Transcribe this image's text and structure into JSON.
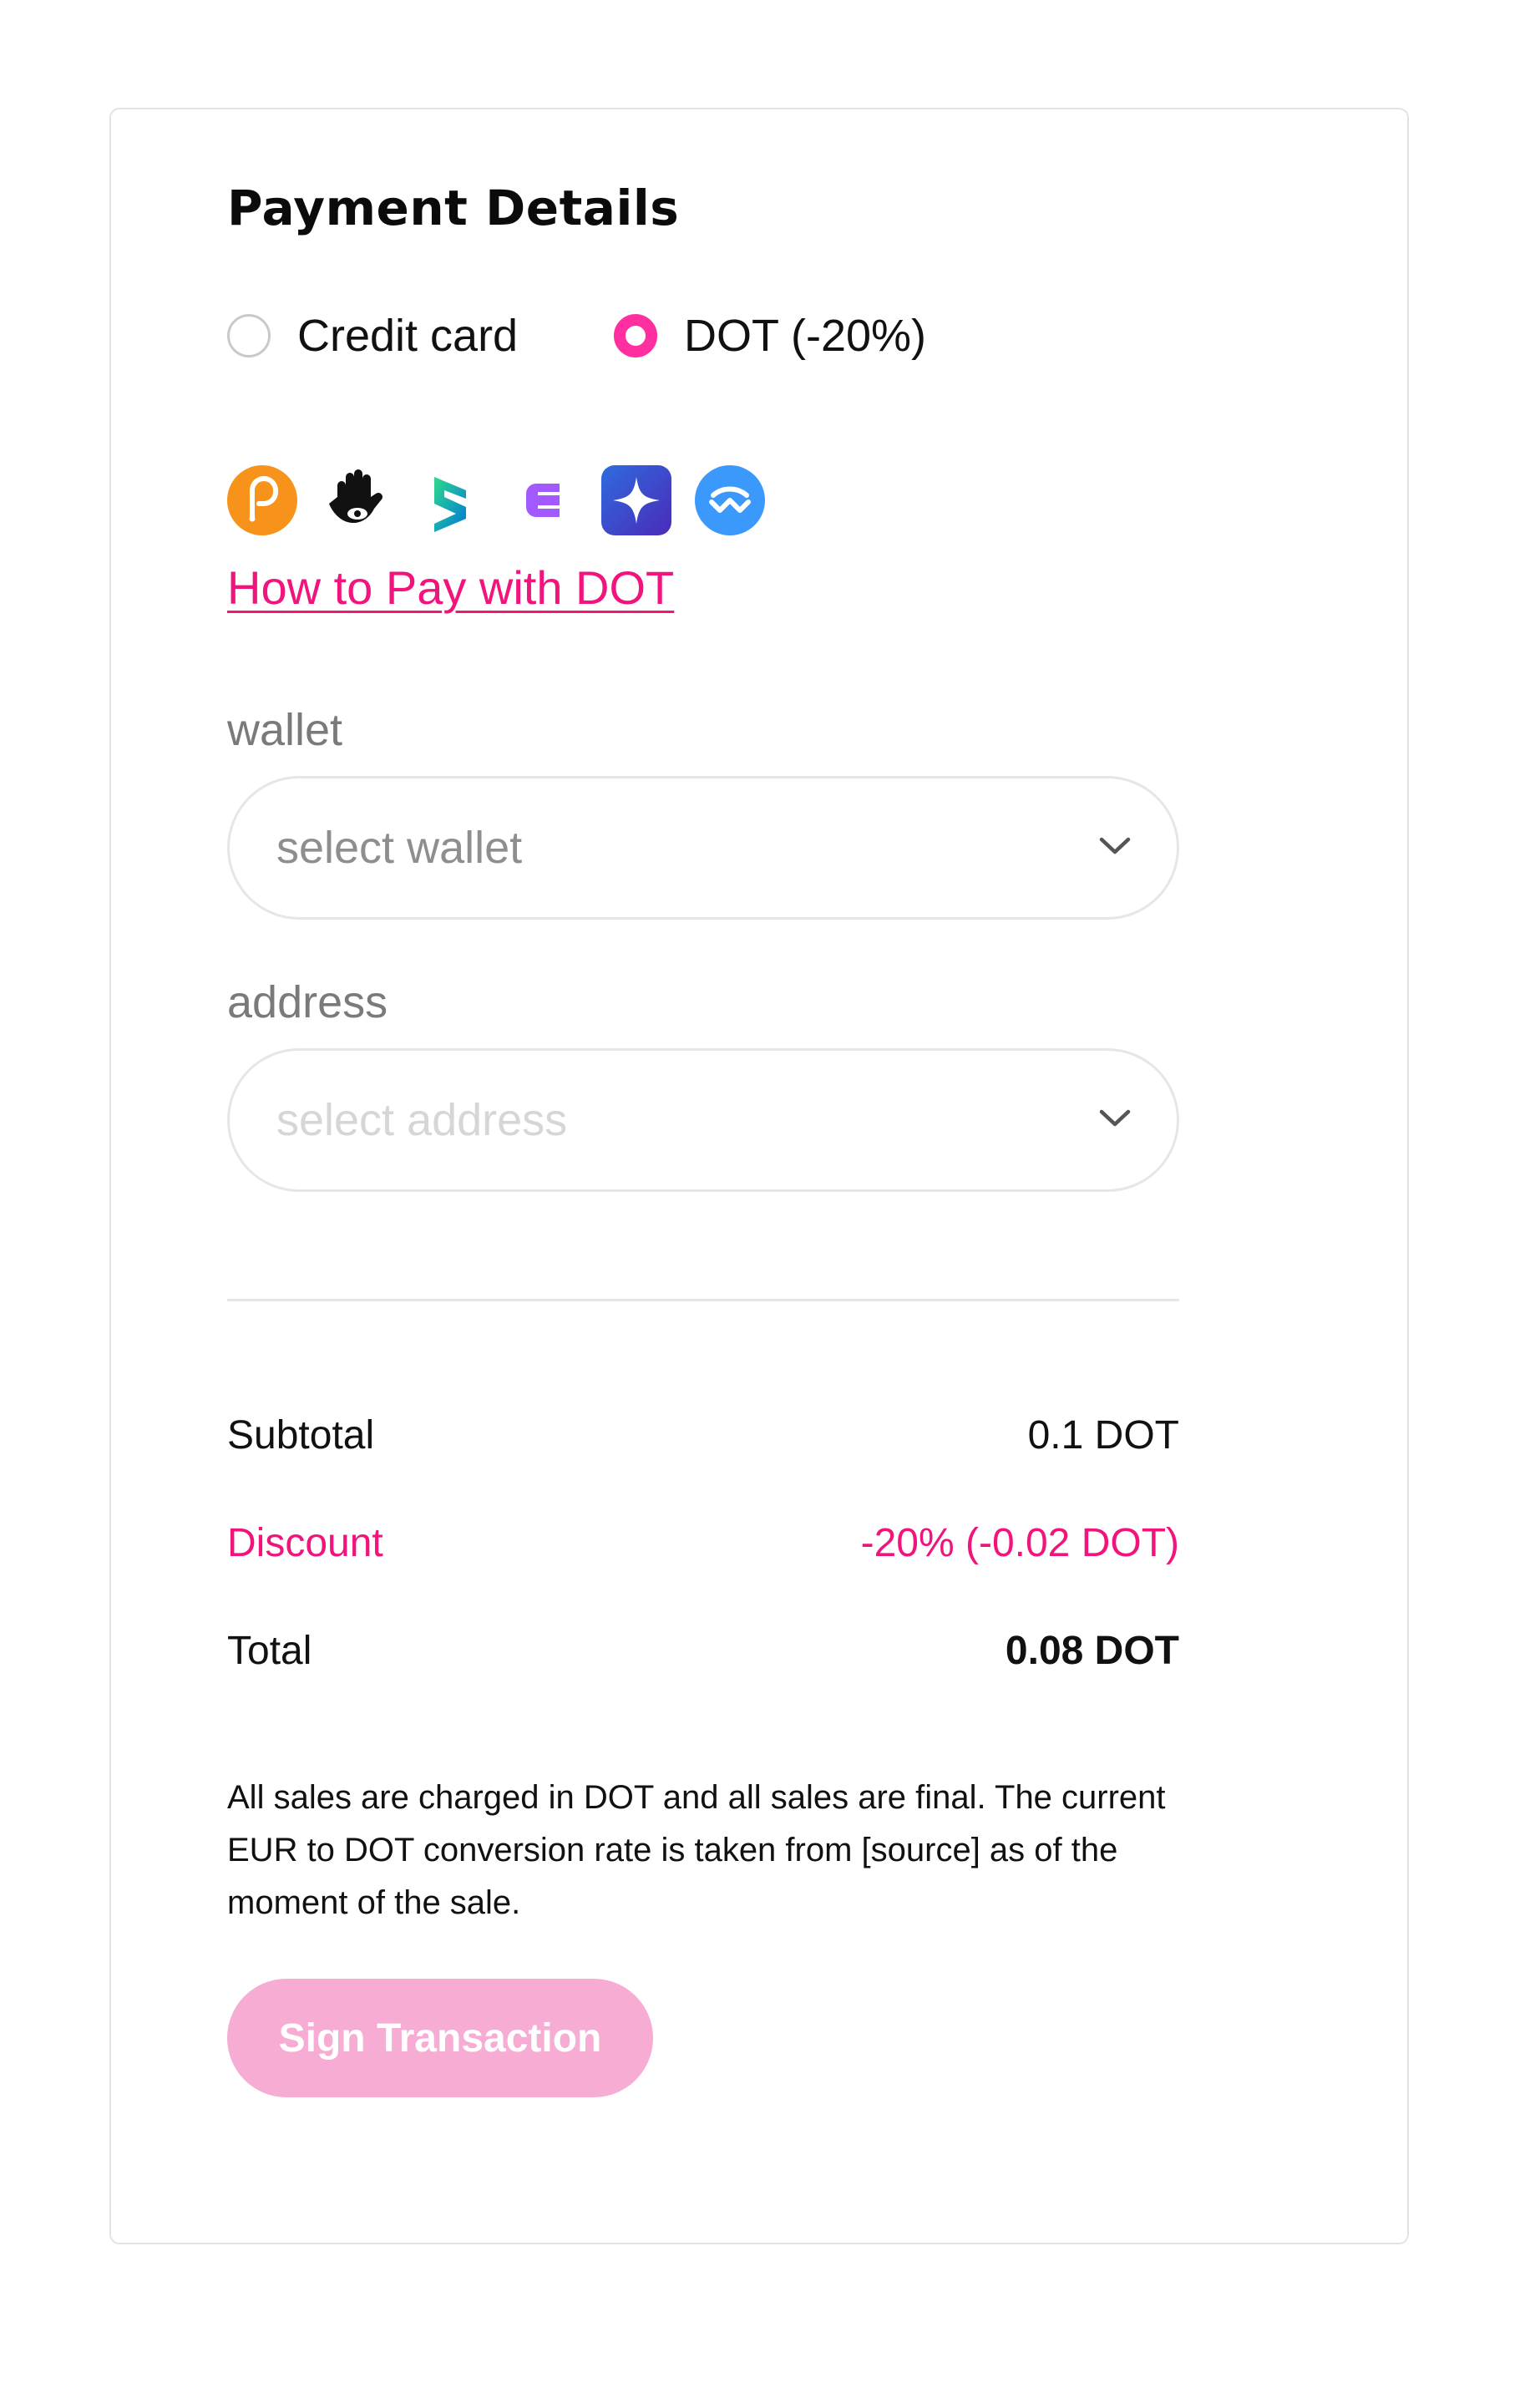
{
  "payment": {
    "title": "Payment Details",
    "options": [
      {
        "label": "Credit card",
        "selected": false
      },
      {
        "label": "DOT (-20%)",
        "selected": true
      }
    ],
    "wallet_icons": [
      "polkadot-icon",
      "talisman-icon",
      "subwallet-icon",
      "enkrypt-icon",
      "nova-icon",
      "walletconnect-icon"
    ],
    "how_to_link": "How to Pay with DOT",
    "wallet": {
      "label": "wallet",
      "placeholder": "select wallet"
    },
    "address": {
      "label": "address",
      "placeholder": "select address"
    },
    "summary": {
      "subtotal_label": "Subtotal",
      "subtotal_value": "0.1 DOT",
      "discount_label": "Discount",
      "discount_value": "-20% (-0.02 DOT)",
      "total_label": "Total",
      "total_value": "0.08 DOT"
    },
    "note": "All sales are charged in DOT and all sales are final. The current EUR to DOT conversion rate is taken from [source] as of the moment of the sale.",
    "sign_button": "Sign Transaction",
    "colors": {
      "accent": "#ff2fa0",
      "link": "#f0147c",
      "button_disabled": "#f6acd3"
    }
  }
}
